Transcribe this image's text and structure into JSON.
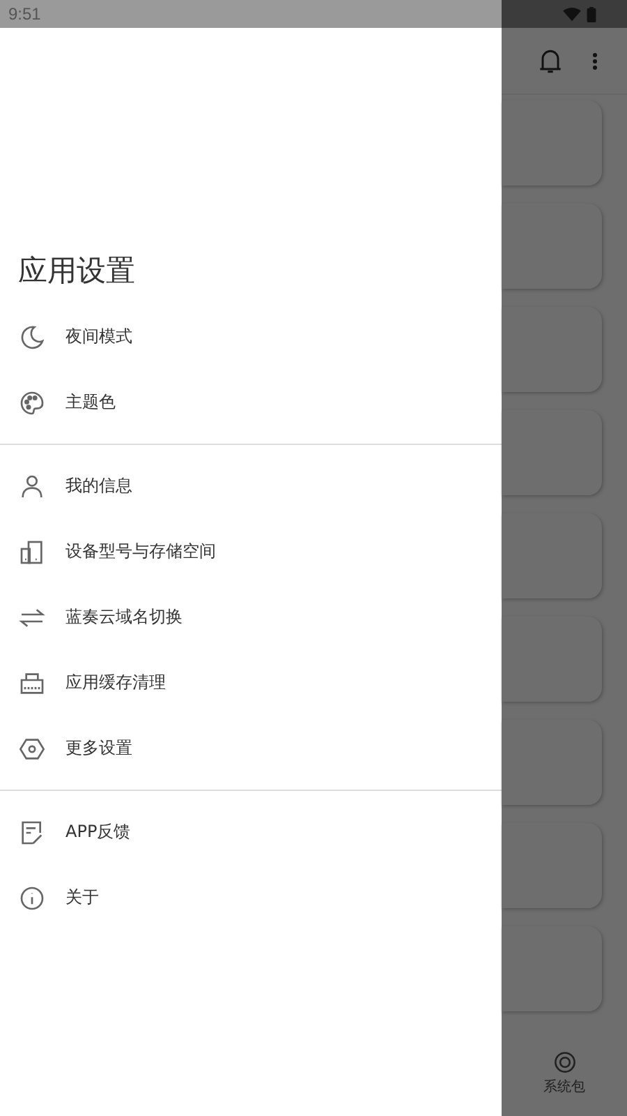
{
  "status_bar": {
    "time": "9:51"
  },
  "drawer": {
    "title": "应用设置",
    "groups": [
      [
        {
          "kind": "moon",
          "label": "夜间模式"
        },
        {
          "kind": "palette",
          "label": "主题色"
        }
      ],
      [
        {
          "kind": "person",
          "label": "我的信息"
        },
        {
          "kind": "device",
          "label": "设备型号与存储空间"
        },
        {
          "kind": "swap",
          "label": "蓝奏云域名切换"
        },
        {
          "kind": "basket",
          "label": "应用缓存清理"
        },
        {
          "kind": "hexagon",
          "label": "更多设置"
        }
      ],
      [
        {
          "kind": "feedback",
          "label": "APP反馈"
        },
        {
          "kind": "info",
          "label": "关于"
        }
      ]
    ]
  },
  "background": {
    "bottom_nav": {
      "label": "系统包"
    }
  }
}
